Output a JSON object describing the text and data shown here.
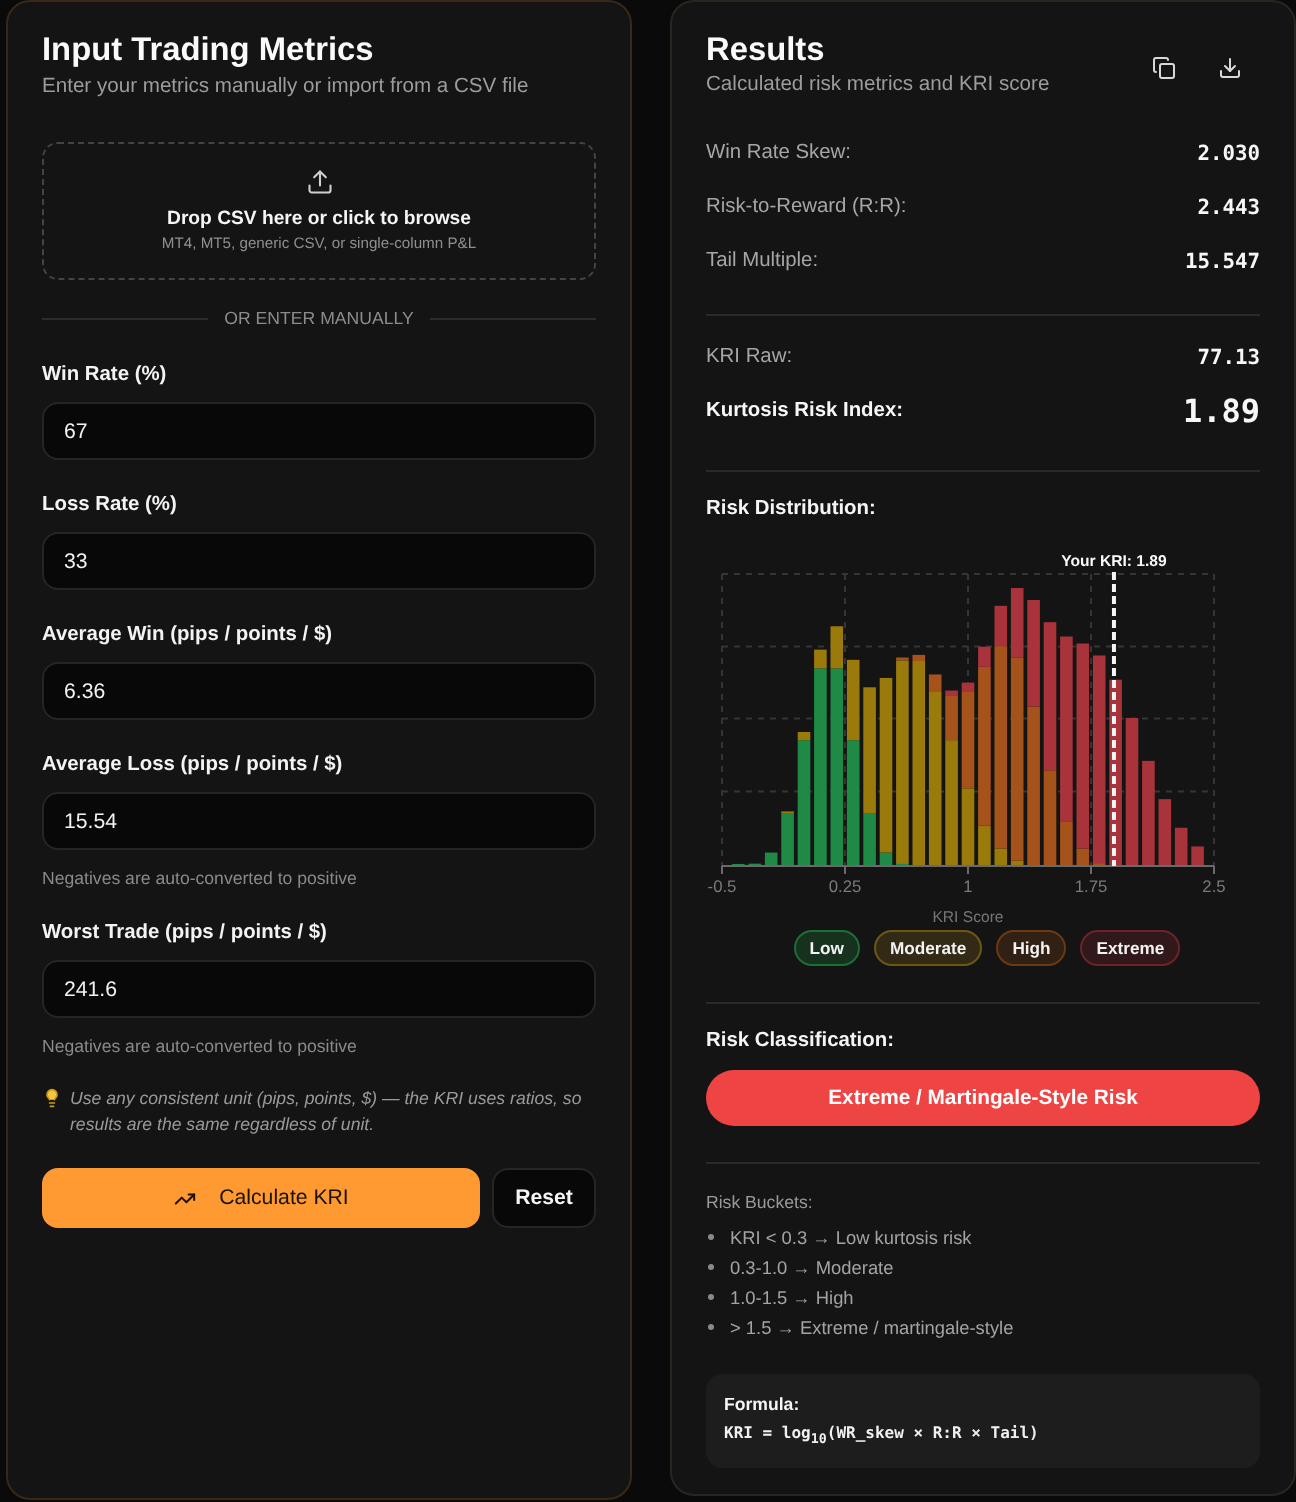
{
  "input_panel": {
    "title": "Input Trading Metrics",
    "subtitle": "Enter your metrics manually or import from a CSV file",
    "dropzone": {
      "title": "Drop CSV here or click to browse",
      "formats": "MT4, MT5, generic CSV, or single-column P&L"
    },
    "divider": "OR ENTER MANUALLY",
    "fields": [
      {
        "label": "Win Rate (%)",
        "value": "67"
      },
      {
        "label": "Loss Rate (%)",
        "value": "33"
      },
      {
        "label": "Average Win (pips / points / $)",
        "value": "6.36"
      },
      {
        "label": "Average Loss (pips / points / $)",
        "value": "15.54",
        "help": "Negatives are auto-converted to positive"
      },
      {
        "label": "Worst Trade (pips / points / $)",
        "value": "241.6",
        "help": "Negatives are auto-converted to positive"
      }
    ],
    "tip": "Use any consistent unit (pips, points, $) — the KRI uses ratios, so results are the same regardless of unit.",
    "buttons": [
      {
        "kind": "primary",
        "label": "Calculate KRI"
      },
      {
        "kind": "secondary",
        "label": "Reset"
      }
    ]
  },
  "results_panel": {
    "title": "Results",
    "subtitle": "Calculated risk metrics and KRI score",
    "metrics": [
      {
        "label": "Win Rate Skew:",
        "value": "2.030"
      },
      {
        "label": "Risk-to-Reward (R:R):",
        "value": "2.443"
      },
      {
        "label": "Tail Multiple:",
        "value": "15.547"
      }
    ],
    "kri": [
      {
        "kind": "raw",
        "label": "KRI Raw:",
        "value": "77.13"
      },
      {
        "kind": "index",
        "label": "Kurtosis Risk Index:",
        "value": "1.89"
      }
    ],
    "distribution": {
      "title": "Risk Distribution:",
      "marker_label": "Your KRI: 1.89",
      "x_ticks": [
        "-0.5",
        "0.25",
        "1",
        "1.75",
        "2.5"
      ],
      "x_label": "KRI Score",
      "legend": [
        {
          "label": "Low",
          "color": "#1d6d37"
        },
        {
          "label": "Moderate",
          "color": "#6e5715"
        },
        {
          "label": "High",
          "color": "#6b3914"
        },
        {
          "label": "Extreme",
          "color": "#6d2329"
        }
      ]
    },
    "classification": {
      "title": "Risk Classification:",
      "label": "Extreme / Martingale-Style Risk"
    },
    "buckets": {
      "title": "Risk Buckets:",
      "items": [
        "KRI < 0.3 → Low kurtosis risk",
        "0.3-1.0 → Moderate",
        "1.0-1.5 → High",
        "> 1.5 → Extreme / martingale-style"
      ]
    },
    "formula": {
      "title": "Formula:",
      "expression": "KRI = log$_{10}$(WR_skew × R:R × Tail)"
    }
  }
}
